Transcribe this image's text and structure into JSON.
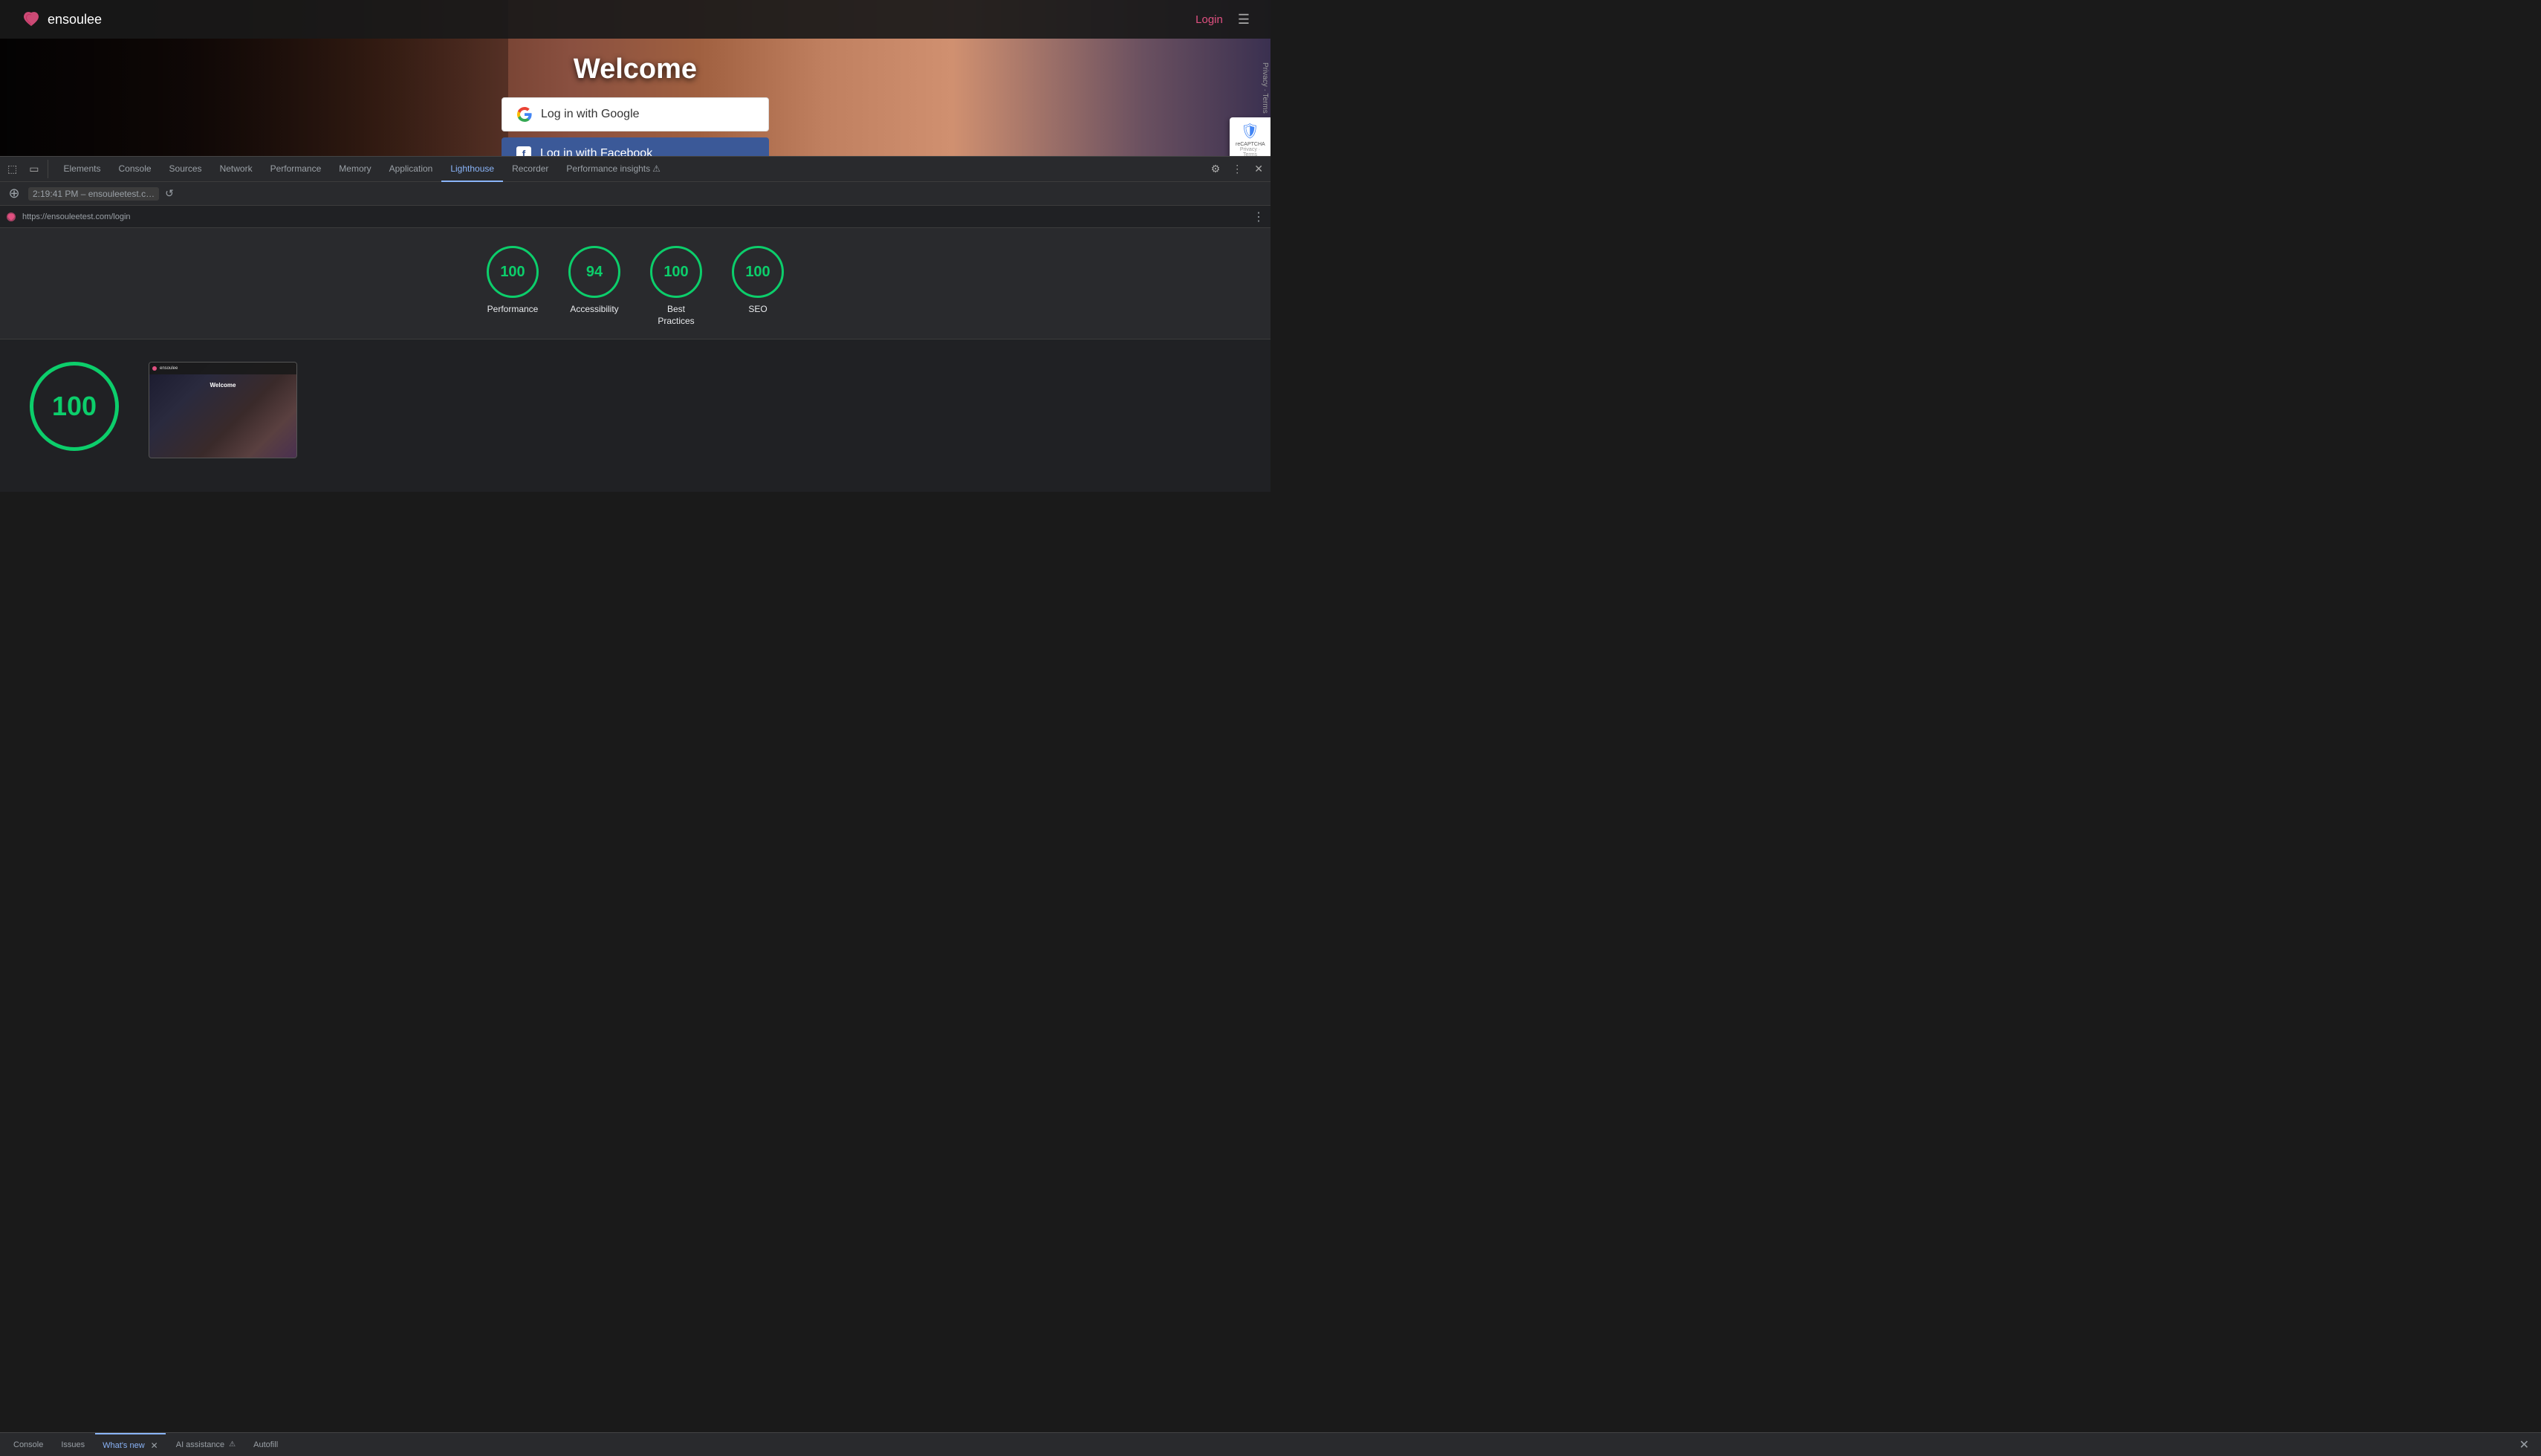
{
  "nav": {
    "logo_text": "ensoulee",
    "login_label": "Login"
  },
  "website": {
    "welcome_title": "Welcome",
    "google_btn_label": "Log in with Google",
    "facebook_btn_label": "Log in with Facebook",
    "url": "https://ensouleetest.com/login",
    "privacy_terms": "Privacy · Terms"
  },
  "devtools": {
    "tabs": [
      {
        "label": "Elements",
        "active": false
      },
      {
        "label": "Console",
        "active": false
      },
      {
        "label": "Sources",
        "active": false
      },
      {
        "label": "Network",
        "active": false
      },
      {
        "label": "Performance",
        "active": false
      },
      {
        "label": "Memory",
        "active": false
      },
      {
        "label": "Application",
        "active": false
      },
      {
        "label": "Lighthouse",
        "active": true
      },
      {
        "label": "Recorder",
        "active": false
      },
      {
        "label": "Performance insights",
        "active": false
      }
    ],
    "toolbar_time": "2:19:41 PM – ensouleetest.c…",
    "url_bar": "https://ensouleetest.com/login"
  },
  "lighthouse": {
    "scores": [
      {
        "value": "100",
        "label": "Performance"
      },
      {
        "value": "94",
        "label": "Accessibility"
      },
      {
        "value": "100",
        "label": "Best\nPractices"
      },
      {
        "value": "100",
        "label": "SEO"
      }
    ],
    "big_score": "100"
  },
  "bottom_bar": {
    "tabs": [
      {
        "label": "Console",
        "active": false
      },
      {
        "label": "Issues",
        "active": false
      },
      {
        "label": "What's new",
        "active": true,
        "closeable": true
      },
      {
        "label": "AI assistance",
        "active": false,
        "has_icon": true
      },
      {
        "label": "Autofill",
        "active": false
      }
    ]
  }
}
